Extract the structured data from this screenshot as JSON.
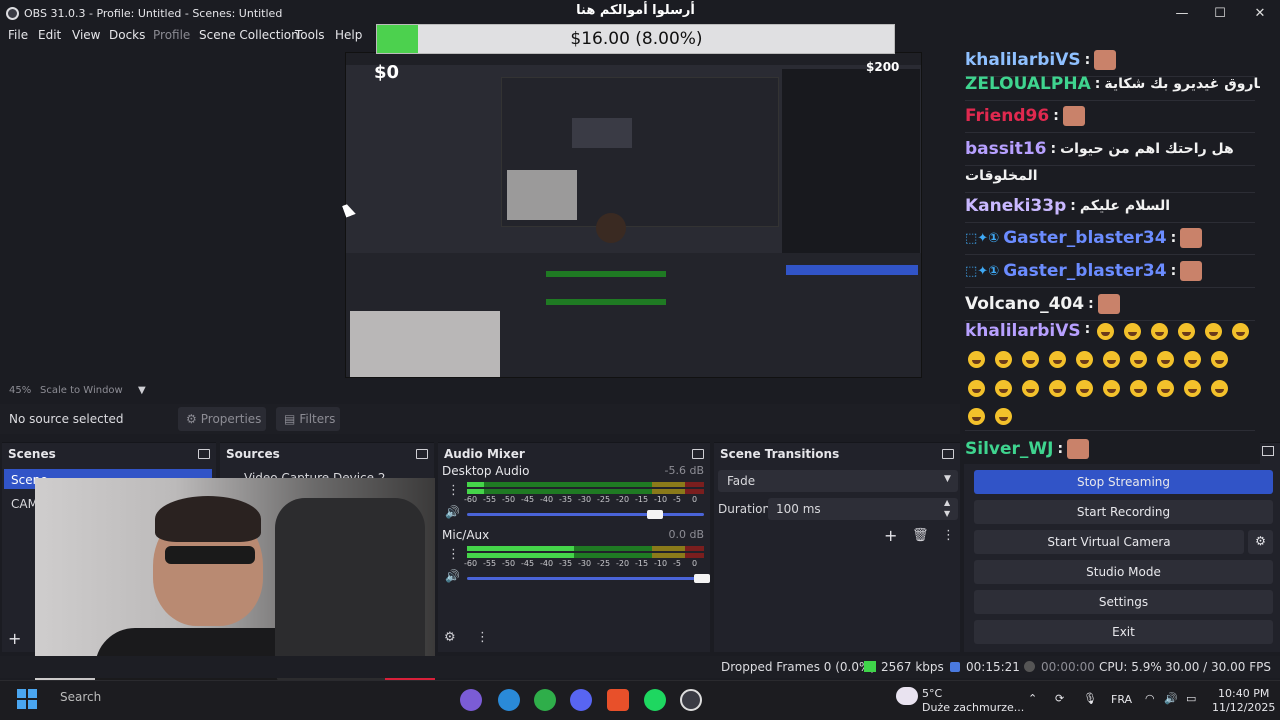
{
  "window": {
    "title": "OBS 31.0.3 - Profile: Untitled - Scenes: Untitled",
    "minimize_icon": "—",
    "maximize_icon": "☐",
    "close_icon": "✕"
  },
  "menu": [
    "File",
    "Edit",
    "View",
    "Docks",
    "Profile",
    "Scene Collection",
    "Tools",
    "Help"
  ],
  "donation": {
    "title": "أرسلوا أموالكم هنا",
    "amount": "$16.00 (8.00%)",
    "progress": 0.08,
    "min": "$0",
    "max": "$200",
    "fill_color": "#4cd14e"
  },
  "preview_toolbar": {
    "zoom": "45%",
    "scale_mode": "Scale to Window"
  },
  "source_bar": {
    "no_source": "No source selected",
    "properties": "Properties",
    "filters": "Filters"
  },
  "scenes": {
    "title": "Scenes",
    "items": [
      "Scene",
      "CAM"
    ]
  },
  "sources": {
    "title": "Sources",
    "items": [
      "Video Capture Device 2"
    ]
  },
  "audio_mixer": {
    "title": "Audio Mixer",
    "channels": [
      {
        "name": "Desktop Audio",
        "db": "-5.6 dB",
        "level": 0.07,
        "volume": 0.8
      },
      {
        "name": "Mic/Aux",
        "db": "0.0 dB",
        "level": 0.45,
        "volume": 1.0
      }
    ],
    "ticks": [
      "-60",
      "-55",
      "-50",
      "-45",
      "-40",
      "-35",
      "-30",
      "-25",
      "-20",
      "-15",
      "-10",
      "-5",
      "0"
    ]
  },
  "scene_transitions": {
    "title": "Scene Transitions",
    "transition": "Fade",
    "duration_label": "Duration",
    "duration_value": "100 ms"
  },
  "chat": [
    {
      "user": "khalilarbiVS",
      "color": "#8fc0ff",
      "msg": "",
      "emote": true
    },
    {
      "user": "ZELOUALPHA",
      "color": "#3fd48f",
      "msg": "فاروق غيديرو بك شكاية"
    },
    {
      "user": "Friend96",
      "color": "#e0294f",
      "msg": "",
      "emote": true
    },
    {
      "user": "bassit16",
      "color": "#b7a0ff",
      "msg": "هل راحتك اهم من حيوات"
    },
    {
      "user": "",
      "color": "#f2f2f2",
      "msg": "المخلوقات"
    },
    {
      "user": "Kaneki33p",
      "color": "#c9b8ff",
      "msg": "السلام عليكم"
    },
    {
      "user": "Gaster_blaster34",
      "color": "#6b8cff",
      "msg": "",
      "emote": true,
      "badges": true
    },
    {
      "user": "Gaster_blaster34",
      "color": "#6b8cff",
      "msg": "",
      "emote": true,
      "badges": true
    },
    {
      "user": "Volcano_404",
      "color": "#f2f2f2",
      "msg": "",
      "emote": true
    },
    {
      "user": "khalilarbiVS",
      "color": "#b7a0ff",
      "msg": "",
      "emojis": true
    },
    {
      "user": "Silver_WJ",
      "color": "#3fd48f",
      "msg": "",
      "emote": true
    }
  ],
  "controls": {
    "stop_streaming": "Stop Streaming",
    "start_recording": "Start Recording",
    "start_virtual_camera": "Start Virtual Camera",
    "studio_mode": "Studio Mode",
    "settings": "Settings",
    "exit": "Exit",
    "active_color": "#3154c7"
  },
  "status": {
    "dropped": "Dropped Frames 0 (0.0%)",
    "kbps": "2567 kbps",
    "stream_time": "00:15:21",
    "rec_time": "00:00:00",
    "cpu": "CPU: 5.9%",
    "fps": "30.00 / 30.00 FPS"
  },
  "taskbar": {
    "search": "Search",
    "weather_temp": "5°C",
    "weather_desc": "Duże zachmurze...",
    "lang": "FRA",
    "time": "10:40 PM",
    "date": "11/12/2025"
  }
}
